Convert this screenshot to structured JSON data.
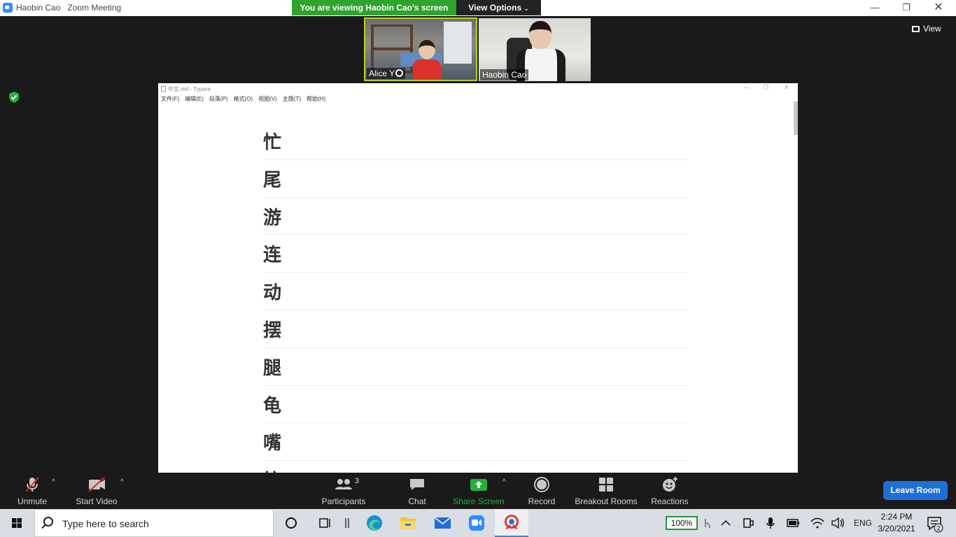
{
  "zoom": {
    "window_title": "Haobin Cao   Zoom Meeting",
    "banner_text": "You are viewing Haobin Cao's screen",
    "view_options_label": "View Options",
    "view_label": "View",
    "participants_thumbs": [
      {
        "name": "Alice Y",
        "active_speaker": true
      },
      {
        "name": "Haobin Cao",
        "active_speaker": false
      }
    ],
    "colors": {
      "banner": "#2ea42e",
      "leave": "#1e6fd9",
      "active_border": "#b6d31a",
      "share_green": "#23b03b"
    }
  },
  "typora": {
    "window_title": "中文.md - Typora",
    "menu": [
      "文件(F)",
      "编辑(E)",
      "段落(P)",
      "格式(O)",
      "视图(V)",
      "主题(T)",
      "帮助(H)"
    ],
    "headings": [
      "忙",
      "尾",
      "游",
      "连",
      "动",
      "摆",
      "腿",
      "龟",
      "嘴",
      "搞"
    ]
  },
  "controls": {
    "unmute": "Unmute",
    "start_video": "Start Video",
    "participants": "Participants",
    "participants_count": "3",
    "chat": "Chat",
    "share_screen": "Share Screen",
    "record": "Record",
    "breakout_rooms": "Breakout Rooms",
    "reactions": "Reactions",
    "leave_room": "Leave Room"
  },
  "taskbar": {
    "search_placeholder": "Type here to search",
    "battery_pct": "100%",
    "language": "ENG",
    "time": "2:24 PM",
    "date": "3/20/2021",
    "notifications": "2"
  }
}
